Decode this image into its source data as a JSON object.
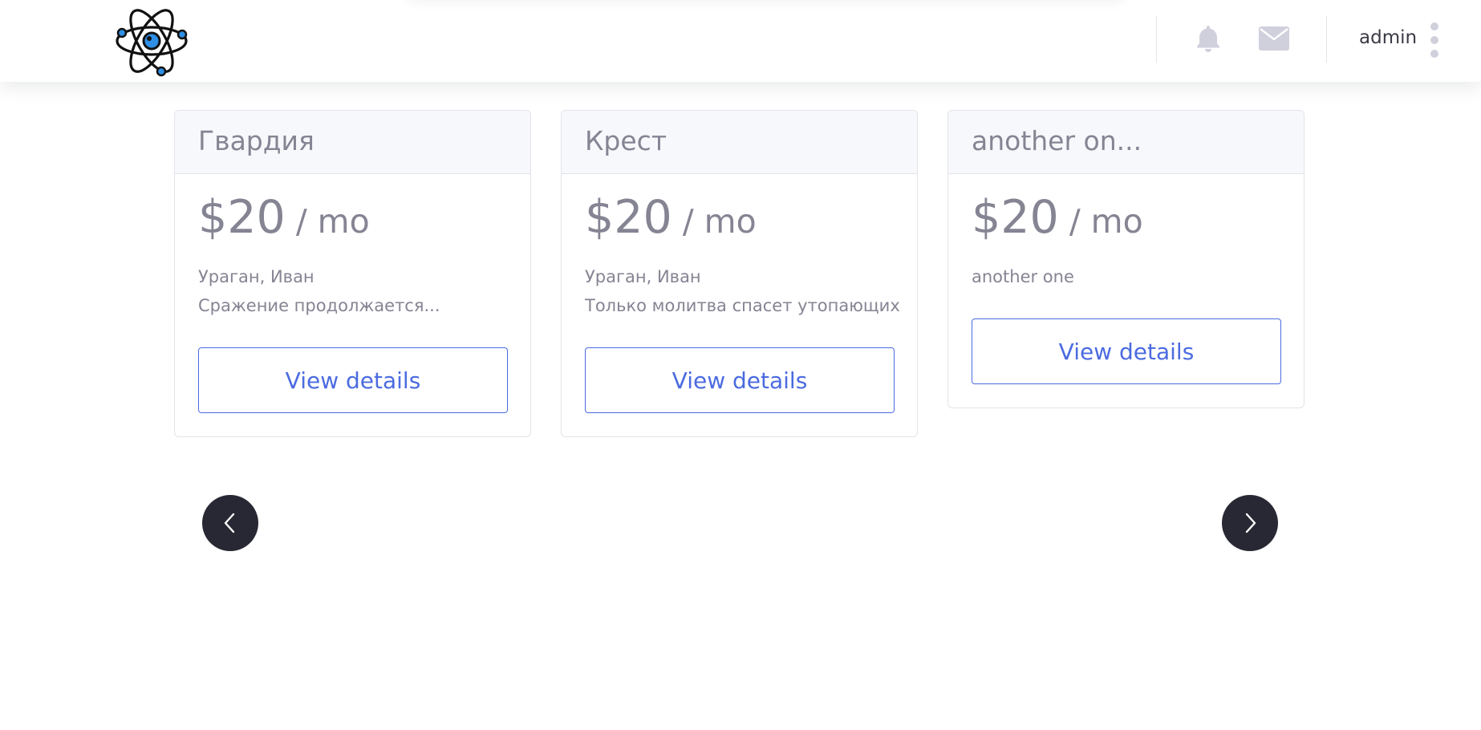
{
  "header": {
    "logo_icon": "atom-icon",
    "notifications_icon": "bell-icon",
    "messages_icon": "envelope-icon",
    "username": "admin",
    "menu_icon": "kebab-menu-icon"
  },
  "cards": [
    {
      "title": "Гвардия",
      "price_amount": "$20",
      "price_unit": " / mo",
      "description_lines": [
        "Ураган, Иван",
        "Сражение продолжается..."
      ],
      "button_label": "View details"
    },
    {
      "title": "Крест",
      "price_amount": "$20",
      "price_unit": " / mo",
      "description_lines": [
        "Ураган, Иван",
        "Только молитва спасет утопающих"
      ],
      "button_label": "View details"
    },
    {
      "title": "another on...",
      "price_amount": "$20",
      "price_unit": " / mo",
      "description_lines": [
        "another one"
      ],
      "button_label": "View details"
    }
  ],
  "carousel": {
    "prev_icon": "chevron-left-icon",
    "next_icon": "chevron-right-icon"
  },
  "colors": {
    "accent": "#4b6be0",
    "nav_button_bg": "#282834",
    "logo_blue": "#2f8fe4",
    "muted_text": "#858493",
    "header_icon": "#d0cfdc"
  }
}
